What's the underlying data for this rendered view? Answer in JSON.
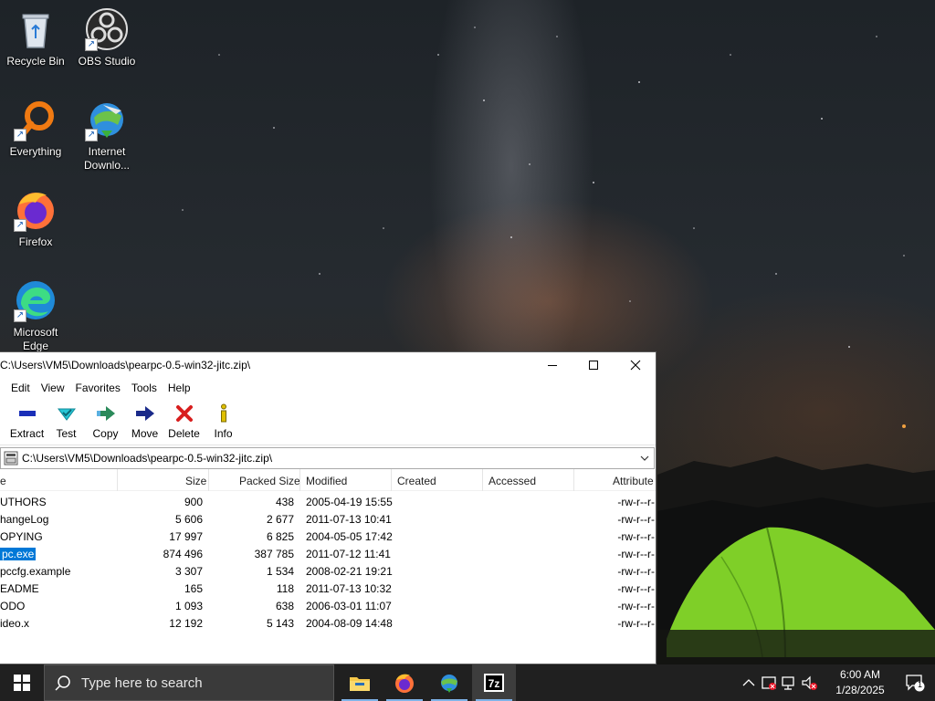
{
  "desktop": {
    "icons": [
      {
        "label": "Recycle Bin",
        "icon": "recycle-bin-icon"
      },
      {
        "label": "OBS Studio",
        "icon": "obs-icon"
      },
      {
        "label": "Everything",
        "icon": "everything-icon"
      },
      {
        "label": "Internet Downlo...",
        "icon": "idm-icon"
      },
      {
        "label": "Firefox",
        "icon": "firefox-icon"
      },
      {
        "label": "Microsoft Edge",
        "icon": "edge-icon"
      }
    ]
  },
  "window": {
    "title": "C:\\Users\\VM5\\Downloads\\pearpc-0.5-win32-jitc.zip\\",
    "controls": {
      "minimize": "minimize",
      "maximize": "maximize",
      "close": "close"
    },
    "menu": [
      "Edit",
      "View",
      "Favorites",
      "Tools",
      "Help"
    ],
    "toolbar": [
      {
        "label": "Extract",
        "icon": "extract-icon",
        "color": "#1a2fb8"
      },
      {
        "label": "Test",
        "icon": "test-icon",
        "color": "#18b6c8"
      },
      {
        "label": "Copy",
        "icon": "copy-icon",
        "color": "#2a8a5a"
      },
      {
        "label": "Move",
        "icon": "move-icon",
        "color": "#1a2a8a"
      },
      {
        "label": "Delete",
        "icon": "delete-icon",
        "color": "#d81e1e"
      },
      {
        "label": "Info",
        "icon": "info-icon",
        "color": "#e0c000"
      }
    ],
    "address": "C:\\Users\\VM5\\Downloads\\pearpc-0.5-win32-jitc.zip\\",
    "columns": [
      "e",
      "Size",
      "Packed Size",
      "Modified",
      "Created",
      "Accessed",
      "Attribute"
    ],
    "files": [
      {
        "name": "UTHORS",
        "size": "900",
        "packed": "438",
        "modified": "2005-04-19 15:55",
        "created": "",
        "accessed": "",
        "attr": "-rw-r--r-"
      },
      {
        "name": "hangeLog",
        "size": "5 606",
        "packed": "2 677",
        "modified": "2011-07-13 10:41",
        "created": "",
        "accessed": "",
        "attr": "-rw-r--r-"
      },
      {
        "name": "OPYING",
        "size": "17 997",
        "packed": "6 825",
        "modified": "2004-05-05 17:42",
        "created": "",
        "accessed": "",
        "attr": "-rw-r--r-"
      },
      {
        "name": "pc.exe",
        "size": "874 496",
        "packed": "387 785",
        "modified": "2011-07-12 11:41",
        "created": "",
        "accessed": "",
        "attr": "-rw-r--r-",
        "selected": true
      },
      {
        "name": "pccfg.example",
        "size": "3 307",
        "packed": "1 534",
        "modified": "2008-02-21 19:21",
        "created": "",
        "accessed": "",
        "attr": "-rw-r--r-"
      },
      {
        "name": "EADME",
        "size": "165",
        "packed": "118",
        "modified": "2011-07-13 10:32",
        "created": "",
        "accessed": "",
        "attr": "-rw-r--r-"
      },
      {
        "name": "ODO",
        "size": "1 093",
        "packed": "638",
        "modified": "2006-03-01 11:07",
        "created": "",
        "accessed": "",
        "attr": "-rw-r--r-"
      },
      {
        "name": "ideo.x",
        "size": "12 192",
        "packed": "5 143",
        "modified": "2004-08-09 14:48",
        "created": "",
        "accessed": "",
        "attr": "-rw-r--r-"
      }
    ]
  },
  "taskbar": {
    "search_placeholder": "Type here to search",
    "apps": [
      {
        "name": "file-explorer",
        "icon": "folder-icon"
      },
      {
        "name": "firefox",
        "icon": "firefox-icon"
      },
      {
        "name": "internet-download-manager",
        "icon": "idm-icon"
      },
      {
        "name": "7-zip",
        "icon": "7zip-icon",
        "active": true
      }
    ],
    "clock": {
      "time": "6:00 AM",
      "date": "1/28/2025"
    },
    "notifications_count": "1",
    "accent": "#7fb3e8"
  }
}
